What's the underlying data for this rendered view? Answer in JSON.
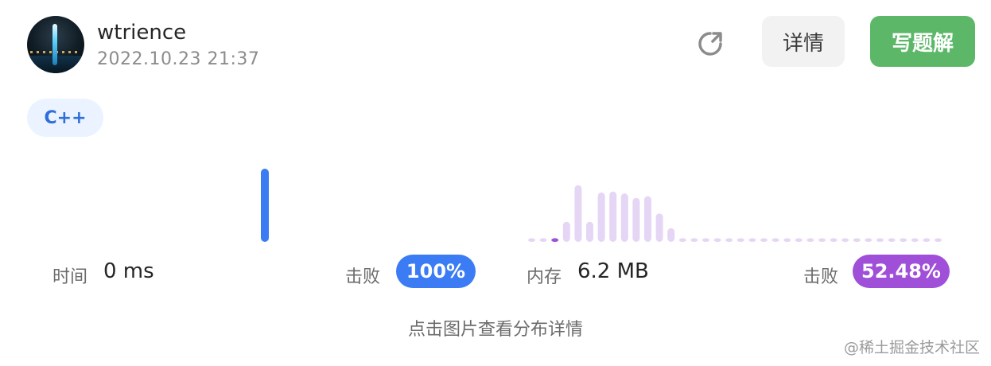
{
  "user": {
    "name": "wtrience",
    "timestamp": "2022.10.23 21:37"
  },
  "actions": {
    "detail_label": "详情",
    "write_solution_label": "写题解"
  },
  "language_tag": "C++",
  "runtime": {
    "label": "时间",
    "value": "0 ms",
    "beats_label": "击败",
    "beats_percent": "100%",
    "highlight_color": "#3b7cf4"
  },
  "memory": {
    "label": "内存",
    "value": "6.2 MB",
    "beats_label": "击败",
    "beats_percent": "52.48%",
    "highlight_color": "#a04fd8",
    "bar_color": "#e6d6f5"
  },
  "chart_data": [
    {
      "type": "bar",
      "name": "runtime-distribution",
      "bars": [
        1.0
      ],
      "highlight_index": 0
    },
    {
      "type": "bar",
      "name": "memory-distribution",
      "bars": [
        0.04,
        0.04,
        0.04,
        0.22,
        0.62,
        0.22,
        0.54,
        0.55,
        0.53,
        0.48,
        0.5,
        0.31,
        0.15,
        0.04,
        0.04,
        0.04,
        0.04,
        0.04,
        0.04,
        0.04,
        0.04,
        0.04,
        0.04,
        0.04,
        0.04,
        0.04,
        0.04,
        0.04,
        0.04,
        0.04,
        0.04,
        0.04,
        0.04,
        0.04,
        0.04,
        0.04
      ],
      "highlight_index": 2
    }
  ],
  "hint": "点击图片查看分布详情",
  "watermark": "@稀土掘金技术社区"
}
